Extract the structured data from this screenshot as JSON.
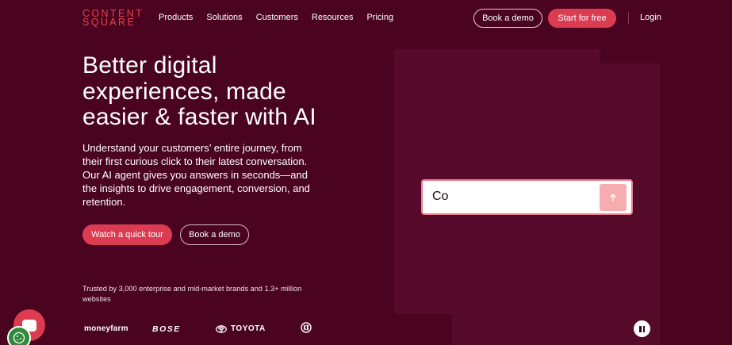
{
  "header": {
    "logo_line1": "CONTENT",
    "logo_line2": "SQUARE",
    "nav": [
      "Products",
      "Solutions",
      "Customers",
      "Resources",
      "Pricing"
    ],
    "book_demo": "Book a demo",
    "start_free": "Start for free",
    "login": "Login"
  },
  "hero": {
    "title_line1": "Better digital",
    "title_line2": "experiences, made",
    "title_line3": "easier & faster with AI",
    "subtitle": "Understand your customers’ entire journey, from their first curious click to their latest conversation. Our AI agent gives you answers in seconds—and the insights to drive engagement, conversion, and retention.",
    "tour_button": "Watch a quick tour",
    "demo_button": "Book a demo",
    "trusted": "Trusted by 3,000 enterprise and mid-market brands and 1.3+ million websites"
  },
  "logos": {
    "moneyfarm": "moneyfarm",
    "bose": "BOSE",
    "toyota": "TOYOTA"
  },
  "prompt": {
    "value": "Co"
  },
  "colors": {
    "background": "#4a0420",
    "accent": "#dc3c52",
    "logo": "#e8424f",
    "panel": "#570a2b"
  },
  "icons": [
    "arrow-up-icon",
    "pause-icon",
    "chat-icon",
    "cookie-icon",
    "toyota-emblem-icon",
    "kb-logo-icon"
  ]
}
